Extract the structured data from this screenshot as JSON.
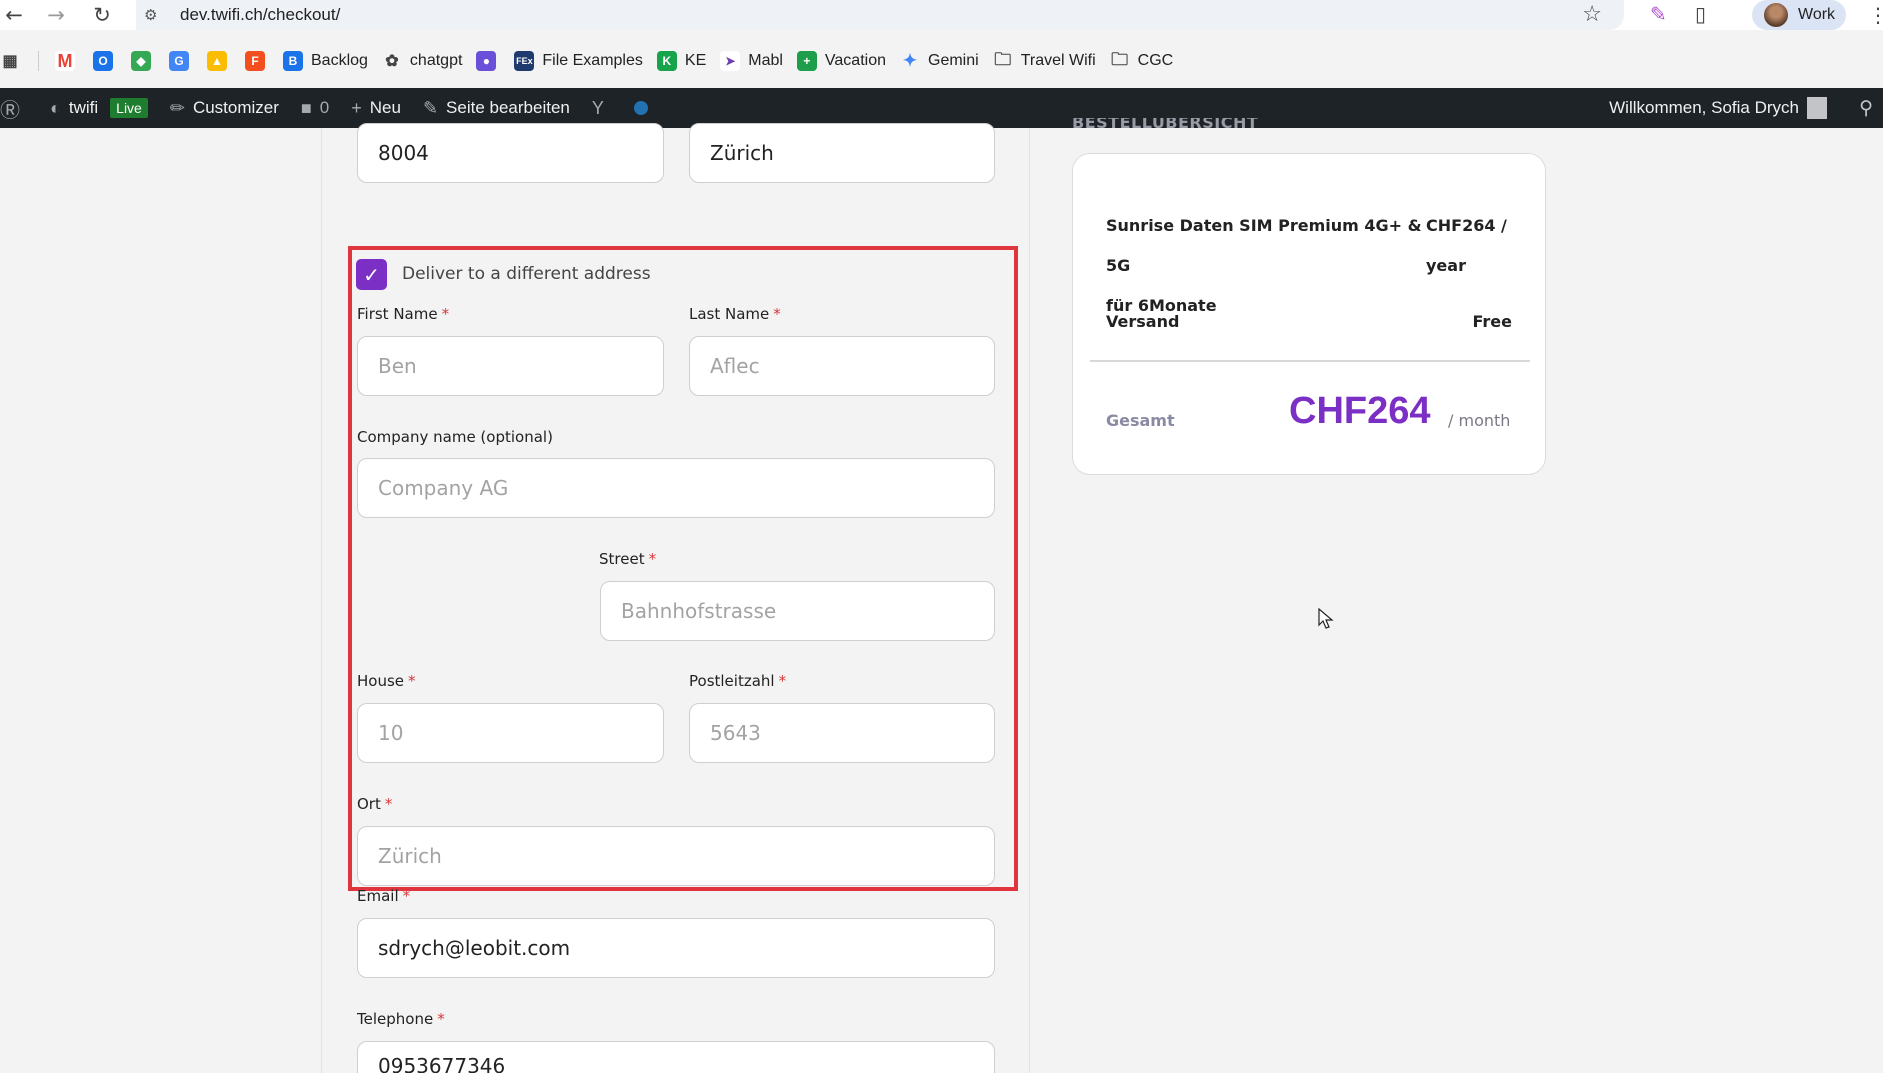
{
  "browser": {
    "url": "dev.twifi.ch/checkout/",
    "profile_label": "Work",
    "bookmarks": [
      {
        "label": "",
        "icon": "gmail-icon"
      },
      {
        "label": "",
        "icon": "outlook-icon"
      },
      {
        "label": "",
        "icon": "app-icon"
      },
      {
        "label": "",
        "icon": "translate-icon"
      },
      {
        "label": "",
        "icon": "drive-icon"
      },
      {
        "label": "",
        "icon": "figma-icon"
      },
      {
        "label": "Backlog",
        "icon": "backlog-icon"
      },
      {
        "label": "chatgpt",
        "icon": "chatgpt-icon"
      },
      {
        "label": "",
        "icon": "app-icon"
      },
      {
        "label": "File Examples",
        "icon": "file-examples-icon"
      },
      {
        "label": "KE",
        "icon": "ke-icon"
      },
      {
        "label": "Mabl",
        "icon": "mabl-icon"
      },
      {
        "label": "Vacation",
        "icon": "vacation-icon"
      },
      {
        "label": "Gemini",
        "icon": "gemini-icon"
      },
      {
        "label": "Travel Wifi",
        "icon": "folder-icon"
      },
      {
        "label": "CGC",
        "icon": "folder-icon"
      }
    ]
  },
  "adminbar": {
    "site": "twifi",
    "live": "Live",
    "customizer": "Customizer",
    "comments": "0",
    "new": "Neu",
    "edit": "Seite bearbeiten",
    "welcome": "Willkommen, Sofia Drych"
  },
  "form": {
    "billing_postcode": "8004",
    "billing_city": "Zürich",
    "ship_different_label": "Deliver to a different address",
    "ship_different_checked": true,
    "first_name_label": "First Name",
    "first_name_placeholder": "Ben",
    "last_name_label": "Last Name",
    "last_name_placeholder": "Aflec",
    "company_label": "Company name (optional)",
    "company_placeholder": "Company AG",
    "street_label": "Street",
    "street_placeholder": "Bahnhofstrasse",
    "house_label": "House",
    "house_placeholder": "10",
    "postcode_label": "Postleitzahl",
    "postcode_placeholder": "5643",
    "city_label": "Ort",
    "city_placeholder": "Zürich",
    "email_label": "Email",
    "email_value": "sdrych@leobit.com",
    "phone_label": "Telephone",
    "phone_value": "0953677346",
    "required_mark": "*"
  },
  "summary": {
    "heading": "BESTELLÜBERSICHT",
    "product_line1": "Sunrise Daten SIM Premium 4G+ & 5G",
    "product_line2": "für 6Monate",
    "price_line1": "CHF264 /",
    "price_line2": "year",
    "shipping_label": "Versand",
    "shipping_value": "Free",
    "total_label": "Gesamt",
    "total_value": "CHF264",
    "total_period": "/ month"
  },
  "colors": {
    "accent": "#7b2fc4",
    "highlight": "#e0353d",
    "adminbar": "#1d2327"
  }
}
